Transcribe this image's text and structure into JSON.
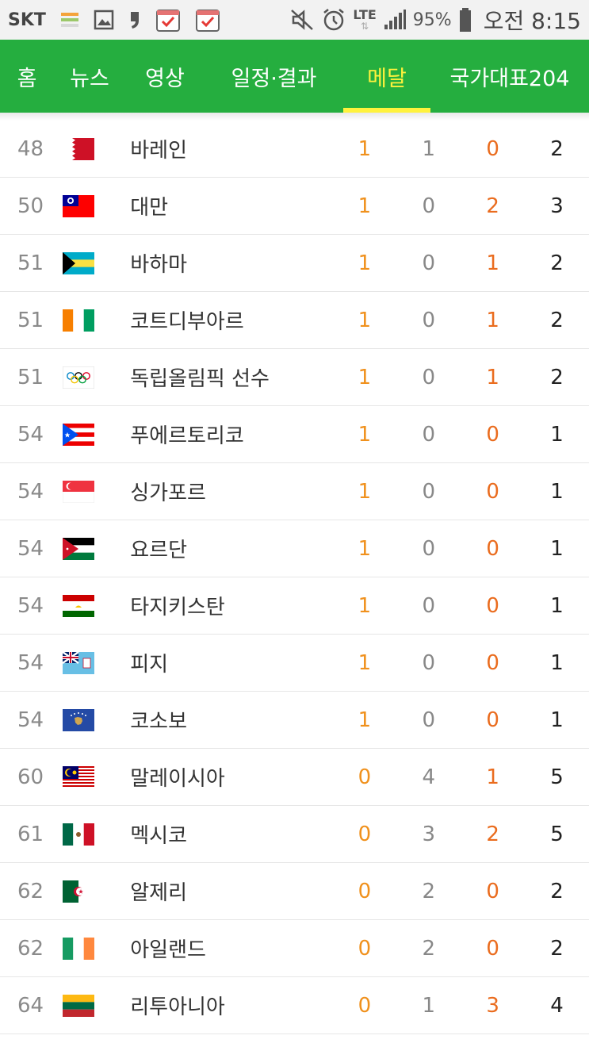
{
  "status_bar": {
    "carrier": "SKT",
    "network": "LTE",
    "battery": "95%",
    "time": "오전 8:15"
  },
  "nav": {
    "tabs": [
      {
        "label": "홈"
      },
      {
        "label": "뉴스"
      },
      {
        "label": "영상"
      },
      {
        "label": "일정·결과"
      },
      {
        "label": "메달",
        "active": true
      },
      {
        "label": "국가대표204"
      }
    ]
  },
  "medal_table": {
    "rows": [
      {
        "rank": "48",
        "country": "바레인",
        "flag": "bahrain-flag",
        "gold": "1",
        "silver": "1",
        "bronze": "0",
        "total": "2"
      },
      {
        "rank": "50",
        "country": "대만",
        "flag": "taiwan-flag",
        "gold": "1",
        "silver": "0",
        "bronze": "2",
        "total": "3"
      },
      {
        "rank": "51",
        "country": "바하마",
        "flag": "bahamas-flag",
        "gold": "1",
        "silver": "0",
        "bronze": "1",
        "total": "2"
      },
      {
        "rank": "51",
        "country": "코트디부아르",
        "flag": "ivory-coast-flag",
        "gold": "1",
        "silver": "0",
        "bronze": "1",
        "total": "2"
      },
      {
        "rank": "51",
        "country": "독립올림픽 선수",
        "flag": "olympic-flag",
        "gold": "1",
        "silver": "0",
        "bronze": "1",
        "total": "2"
      },
      {
        "rank": "54",
        "country": "푸에르토리코",
        "flag": "puerto-rico-flag",
        "gold": "1",
        "silver": "0",
        "bronze": "0",
        "total": "1"
      },
      {
        "rank": "54",
        "country": "싱가포르",
        "flag": "singapore-flag",
        "gold": "1",
        "silver": "0",
        "bronze": "0",
        "total": "1"
      },
      {
        "rank": "54",
        "country": "요르단",
        "flag": "jordan-flag",
        "gold": "1",
        "silver": "0",
        "bronze": "0",
        "total": "1"
      },
      {
        "rank": "54",
        "country": "타지키스탄",
        "flag": "tajikistan-flag",
        "gold": "1",
        "silver": "0",
        "bronze": "0",
        "total": "1"
      },
      {
        "rank": "54",
        "country": "피지",
        "flag": "fiji-flag",
        "gold": "1",
        "silver": "0",
        "bronze": "0",
        "total": "1"
      },
      {
        "rank": "54",
        "country": "코소보",
        "flag": "kosovo-flag",
        "gold": "1",
        "silver": "0",
        "bronze": "0",
        "total": "1"
      },
      {
        "rank": "60",
        "country": "말레이시아",
        "flag": "malaysia-flag",
        "gold": "0",
        "silver": "4",
        "bronze": "1",
        "total": "5"
      },
      {
        "rank": "61",
        "country": "멕시코",
        "flag": "mexico-flag",
        "gold": "0",
        "silver": "3",
        "bronze": "2",
        "total": "5"
      },
      {
        "rank": "62",
        "country": "알제리",
        "flag": "algeria-flag",
        "gold": "0",
        "silver": "2",
        "bronze": "0",
        "total": "2"
      },
      {
        "rank": "62",
        "country": "아일랜드",
        "flag": "ireland-flag",
        "gold": "0",
        "silver": "2",
        "bronze": "0",
        "total": "2"
      },
      {
        "rank": "64",
        "country": "리투아니아",
        "flag": "lithuania-flag",
        "gold": "0",
        "silver": "1",
        "bronze": "3",
        "total": "4"
      }
    ]
  },
  "colors": {
    "nav_bg": "#25ae3f",
    "active_tab": "#fff23d",
    "gold": "#f0911d",
    "bronze": "#ea6c1e",
    "silver": "#888888"
  }
}
